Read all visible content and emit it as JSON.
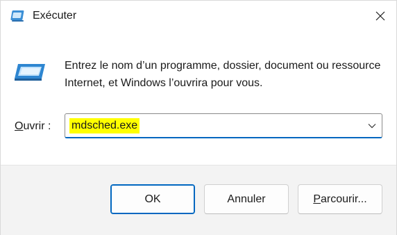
{
  "window": {
    "title": "Exécuter",
    "app_icon": "run-dialog-icon",
    "close_icon": "close-icon"
  },
  "dialog": {
    "description": "Entrez le nom d’un programme, dossier, document ou ressource Internet, et Windows l’ouvrira pour vous.",
    "open_label_prefix": "",
    "open_label_access_key": "O",
    "open_label_rest": "uvrir :",
    "input_value": "mdsched.exe",
    "dropdown_icon": "chevron-down-icon",
    "highlight_color": "#ffff00"
  },
  "buttons": {
    "ok": "OK",
    "cancel": "Annuler",
    "browse_access_key": "P",
    "browse_rest": "arcourir..."
  },
  "colors": {
    "accent": "#0067c0",
    "footer_bg": "#f3f3f3"
  }
}
